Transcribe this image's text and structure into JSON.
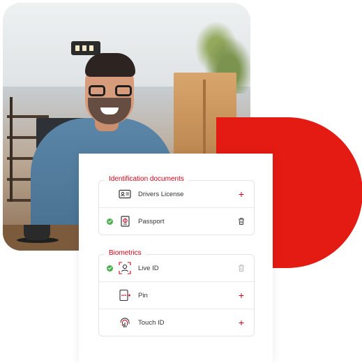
{
  "sections": [
    {
      "title": "Identification documents",
      "items": [
        {
          "label": "Drivers License",
          "verified": false,
          "icon": "id-card-icon",
          "action": "add-icon"
        },
        {
          "label": "Passport",
          "verified": true,
          "icon": "passport-icon",
          "action": "trash-icon"
        }
      ]
    },
    {
      "title": "Biometrics",
      "items": [
        {
          "label": "Live ID",
          "verified": true,
          "icon": "face-scan-icon",
          "action": "trash-icon"
        },
        {
          "label": "Pin",
          "verified": false,
          "icon": "pin-keypad-icon",
          "action": "add-icon"
        },
        {
          "label": "Touch ID",
          "verified": false,
          "icon": "fingerprint-icon",
          "action": "add-icon"
        }
      ]
    }
  ],
  "colors": {
    "accent": "#e41b13",
    "section_title": "#d0021b",
    "verified": "#4caf50"
  }
}
